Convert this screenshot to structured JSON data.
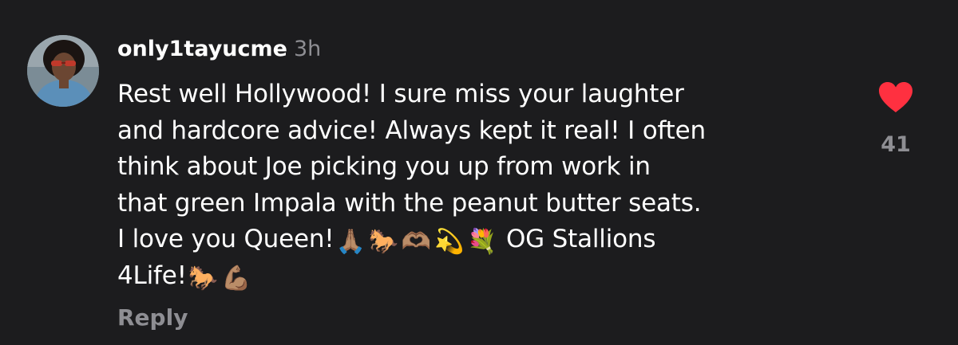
{
  "comment": {
    "username": "only1tayucme",
    "timestamp": "3h",
    "text_lines": [
      "Rest well Hollywood! I sure miss your laughter",
      "and hardcore advice! Always kept it real! I often",
      "think about Joe picking you up from work in",
      "that green Impala with the peanut butter seats.",
      "I love you Queen!",
      "OG Stallions",
      "4Life!"
    ],
    "emojis": {
      "pray": "🙏🏽",
      "horse": "🐎",
      "heart_hands": "🫶🏽",
      "dizzy": "💫",
      "bouquet": "💐",
      "flexed_biceps": "💪🏽"
    },
    "reply_label": "Reply",
    "like_count": "41",
    "liked": true
  },
  "colors": {
    "background": "#1c1c1e",
    "text_primary": "#ffffff",
    "text_secondary": "#8e8e93",
    "like_heart": "#ff3040"
  },
  "icons": {
    "avatar": "user-avatar-photo",
    "like": "heart-filled-icon"
  }
}
